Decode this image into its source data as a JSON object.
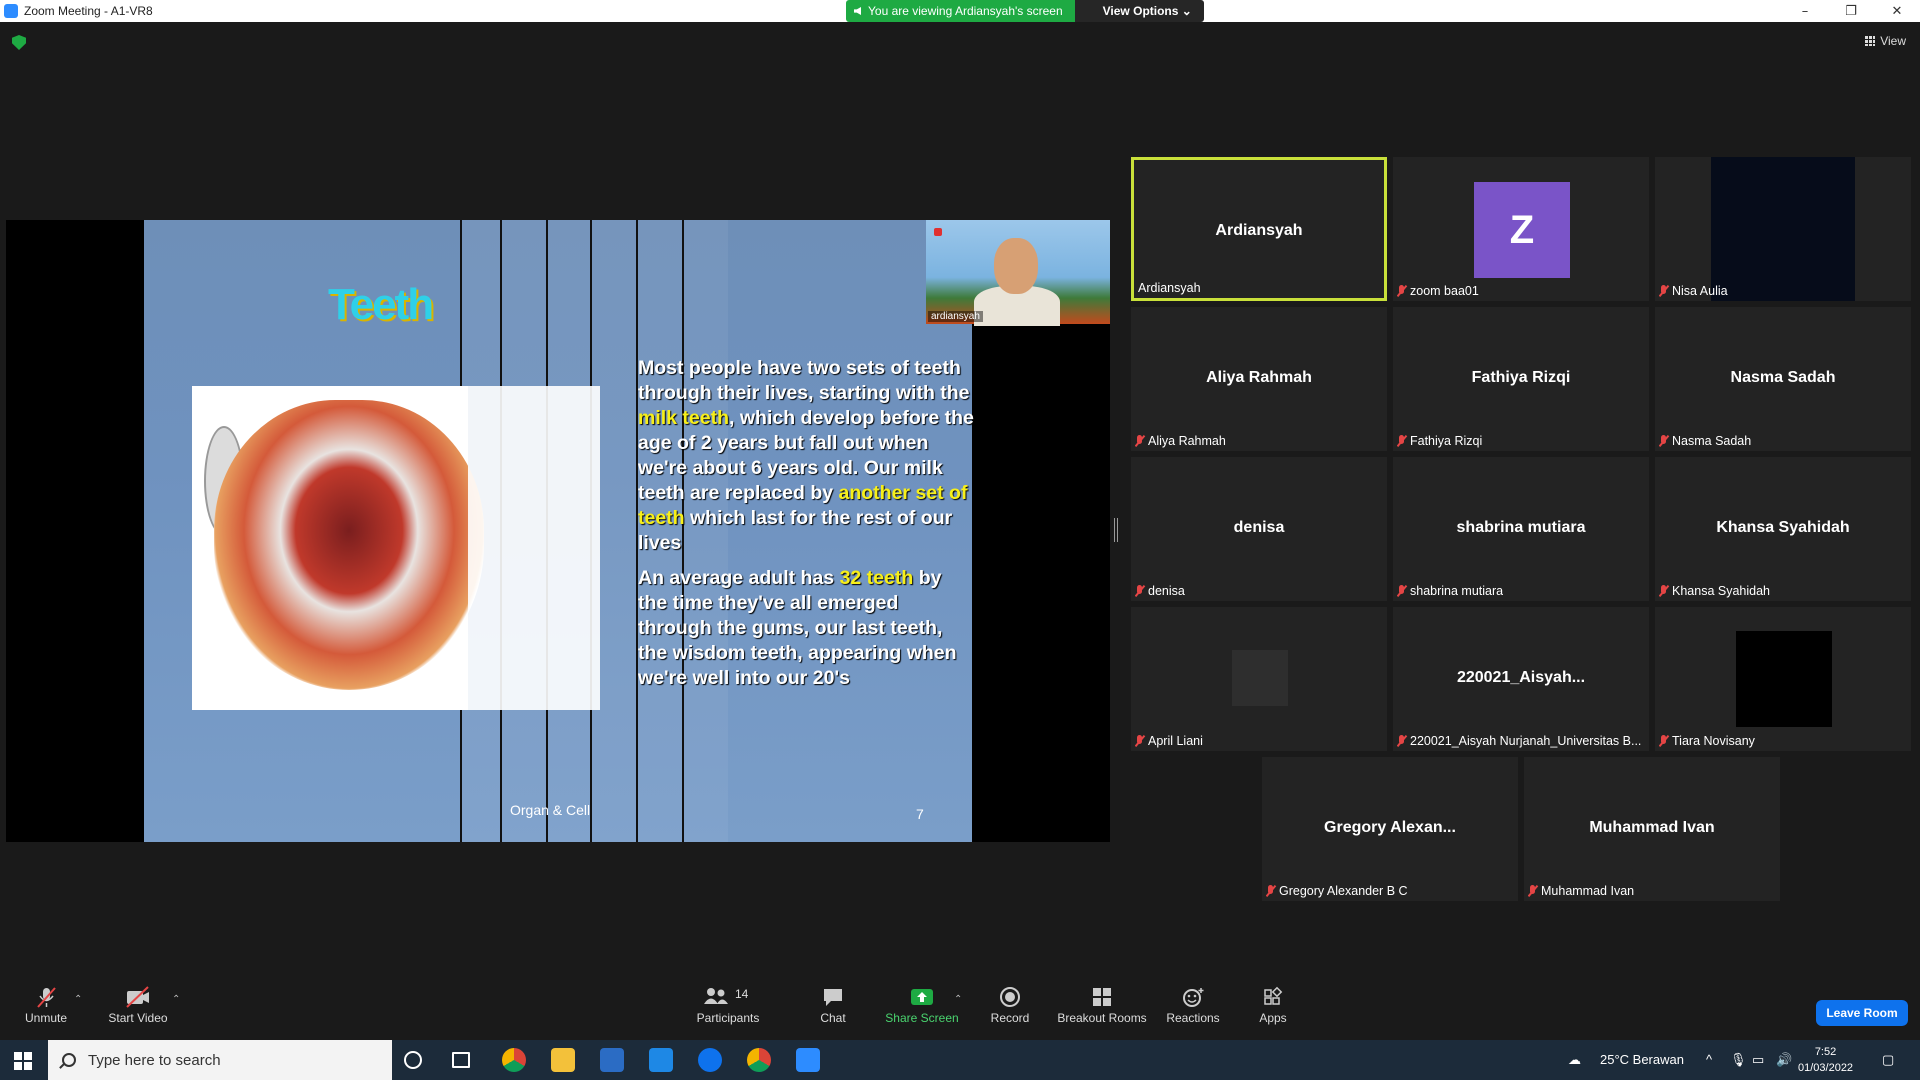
{
  "window": {
    "title": "Zoom Meeting - A1-VR8",
    "controls": [
      "–",
      "❐",
      "✕"
    ]
  },
  "share_banner": {
    "viewing": "You are viewing Ardiansyah's screen",
    "view_options": "View Options ⌄"
  },
  "view_button": "View",
  "slide": {
    "title": "Teeth",
    "paragraph1_a": "Most people have two sets of teeth through their lives, starting with the ",
    "paragraph1_hl1": "milk teeth",
    "paragraph1_b": ", which develop before the age of 2 years but fall out when we're about 6 years old. Our milk teeth are replaced by ",
    "paragraph1_hl2": "another set of teeth",
    "paragraph1_c": " which last for the rest of our lives",
    "paragraph2_a": "An average adult has ",
    "paragraph2_hl": "32 teeth",
    "paragraph2_b": " by the time they've all emerged through the gums, our last teeth, the wisdom teeth, appearing when we're well into our 20's",
    "footer": "Organ & Cell",
    "page_number": "7",
    "highlight_color": "#f7ef1a"
  },
  "presenter_cam": {
    "label": "ardiansyah"
  },
  "participants": [
    {
      "big": "Ardiansyah",
      "small": "Ardiansyah",
      "muted": false,
      "active": true,
      "kind": "name"
    },
    {
      "big": "Z",
      "small": "zoom baa01",
      "muted": true,
      "active": false,
      "kind": "avatar"
    },
    {
      "big": "",
      "small": "Nisa Aulia",
      "muted": true,
      "active": false,
      "kind": "video-dark"
    },
    {
      "big": "Aliya Rahmah",
      "small": "Aliya Rahmah",
      "muted": true,
      "active": false,
      "kind": "name"
    },
    {
      "big": "Fathiya Rizqi",
      "small": "Fathiya Rizqi",
      "muted": true,
      "active": false,
      "kind": "name"
    },
    {
      "big": "Nasma Sadah",
      "small": "Nasma Sadah",
      "muted": true,
      "active": false,
      "kind": "name"
    },
    {
      "big": "denisa",
      "small": "denisa",
      "muted": true,
      "active": false,
      "kind": "name"
    },
    {
      "big": "shabrina mutiara",
      "small": "shabrina mutiara",
      "muted": true,
      "active": false,
      "kind": "name"
    },
    {
      "big": "Khansa Syahidah",
      "small": "Khansa Syahidah",
      "muted": true,
      "active": false,
      "kind": "name"
    },
    {
      "big": "",
      "small": "April Liani",
      "muted": true,
      "active": false,
      "kind": "grey-box"
    },
    {
      "big": "220021_Aisyah...",
      "small": "220021_Aisyah Nurjanah_Universitas B...",
      "muted": true,
      "active": false,
      "kind": "name"
    },
    {
      "big": "",
      "small": "Tiara Novisany",
      "muted": true,
      "active": false,
      "kind": "black-box"
    },
    {
      "big": "Gregory  Alexan...",
      "small": "Gregory Alexander B C",
      "muted": true,
      "active": false,
      "kind": "name"
    },
    {
      "big": "Muhammad Ivan",
      "small": "Muhammad Ivan",
      "muted": true,
      "active": false,
      "kind": "name"
    }
  ],
  "toolbar": {
    "unmute": "Unmute",
    "start_video": "Start Video",
    "participants": "Participants",
    "participants_count": "14",
    "chat": "Chat",
    "share_screen": "Share Screen",
    "record": "Record",
    "breakout_rooms": "Breakout Rooms",
    "reactions": "Reactions",
    "apps": "Apps",
    "leave_room": "Leave Room"
  },
  "taskbar": {
    "search_placeholder": "Type here to search",
    "weather": "25°C  Berawan",
    "time": "7:52",
    "date": "01/03/2022"
  }
}
